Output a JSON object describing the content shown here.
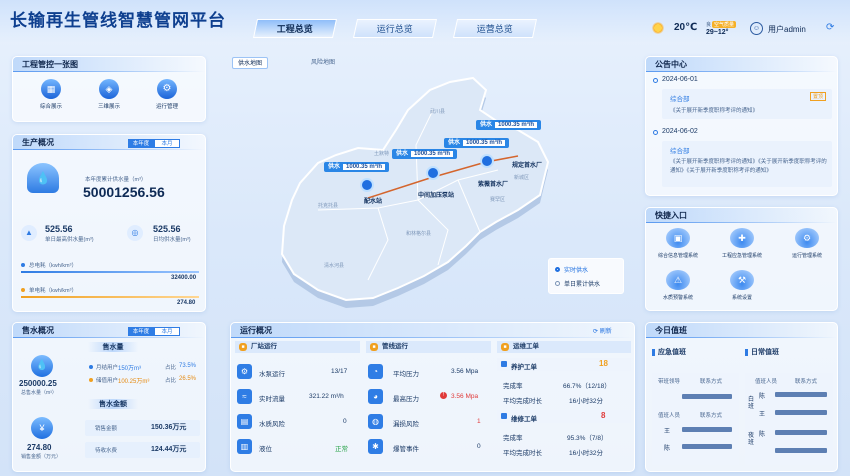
{
  "header": {
    "title": "长输再生管线智慧管网平台",
    "user": "用户admin",
    "weather": {
      "temp": "20℃",
      "aqi_label": "良",
      "aqi": "空气质量",
      "range": "29~12°"
    }
  },
  "tabs": [
    {
      "label": "工程总览",
      "active": true
    },
    {
      "label": "运行总览",
      "active": false
    },
    {
      "label": "运营总览",
      "active": false
    }
  ],
  "left": {
    "eng": {
      "title": "工程管控一张图",
      "items": [
        "综合展示",
        "三维展示",
        "运行管理"
      ]
    },
    "prod": {
      "title": "生产概况",
      "seg": [
        "本年度",
        "本月"
      ],
      "meter_label": "本年度累计供水量（m³）",
      "meter_value": "50001256.56",
      "max_value": "525.56",
      "max_label": "单日最高供水量(m³)",
      "avg_value": "525.56",
      "avg_label": "日均供水量(m³)",
      "elec1_label": "总电耗（kwh/km³）",
      "elec1_value": "32400.00",
      "elec2_label": "单电耗（kwh/km³）",
      "elec2_value": "274.80"
    },
    "sale": {
      "title": "售水概况",
      "seg": [
        "本年度",
        "本月"
      ],
      "vol_label": "售水量",
      "amt_label": "售水金额",
      "sum_value": "250000.25",
      "sum_label": "总售水量（m³）",
      "u1": "月结用户",
      "u1v": "150万m³",
      "u1p": "占比",
      "u1pv": "73.5%",
      "u2": "储值用户",
      "u2v": "100.25万m³",
      "u2p": "占比",
      "u2pv": "26.5%",
      "money_value": "274.80",
      "money_label": "销售金额（万元）",
      "r1": "销售金额",
      "r1v": "150.36万元",
      "r2": "待收水费",
      "r2v": "124.44万元"
    }
  },
  "map": {
    "toggle": [
      "供水地图",
      "风险地图"
    ],
    "stations": [
      {
        "name": "中间加压泵站"
      },
      {
        "name": "配水站"
      },
      {
        "name": "紫薇首水厂"
      },
      {
        "name": "规定首水厂"
      }
    ],
    "flows": [
      {
        "label": "供水",
        "value": "1000.35 m³/h"
      },
      {
        "label": "供水",
        "value": "1000.35 m³/h"
      },
      {
        "label": "供水",
        "value": "1000.35 m³/h"
      },
      {
        "label": "供水",
        "value": "1000.35 m³/h"
      }
    ],
    "regions": [
      "武川县",
      "土默特",
      "赛罕区",
      "新城区",
      "和林格尔县",
      "清水河县",
      "托克托县"
    ],
    "legend": [
      "实时供水",
      "单日累计供水"
    ]
  },
  "ops": {
    "title": "运行概况",
    "refresh": "刷新",
    "plant": {
      "title": "厂站运行",
      "rows": [
        {
          "k": "水泵运行",
          "v": "13/17"
        },
        {
          "k": "实时流量",
          "v": "321.22 m³/h"
        },
        {
          "k": "水质风险",
          "v": "0"
        },
        {
          "k": "液位",
          "v": "正常"
        }
      ]
    },
    "pipe": {
      "title": "管线运行",
      "rows": [
        {
          "k": "平均压力",
          "v": "3.56 Mpa"
        },
        {
          "k": "最高压力",
          "v": "3.56 Mpa"
        },
        {
          "k": "漏损风险",
          "v": "1"
        },
        {
          "k": "爆管事件",
          "v": "0"
        }
      ]
    },
    "work": {
      "title": "运维工单",
      "a_title": "养护工单",
      "a_count": "18",
      "a_rate_k": "完成率",
      "a_rate_v": "66.7%（12/18）",
      "a_time_k": "平均完成时长",
      "a_time_v": "16小时32分",
      "b_title": "维修工单",
      "b_count": "8",
      "b_rate_k": "完成率",
      "b_rate_v": "95.3%（7/8）",
      "b_time_k": "平均完成时长",
      "b_time_v": "16小时32分"
    }
  },
  "right": {
    "notice": {
      "title": "公告中心",
      "items": [
        {
          "date": "2024-06-01",
          "dept": "综合部",
          "tag": "置顶",
          "text": "《关于展开新季度职称考评的通知》"
        },
        {
          "date": "2024-06-02",
          "dept": "综合部",
          "tag": "",
          "text": "《关于展开新季度职称考评的通知》《关于展开新季度职称考评的通知》《关于展开新季度职称考评的通知》"
        }
      ]
    },
    "quick": {
      "title": "快捷入口",
      "items": [
        "综合信息管理系统",
        "工程应急管理系统",
        "运行管理系统",
        "水质预警系统",
        "系统设置"
      ]
    },
    "duty": {
      "title": "今日值班",
      "emerg": "应急值班",
      "daily": "日常值班",
      "c1": [
        "带班领导",
        "联系方式"
      ],
      "c2": [
        "值班人员",
        "联系方式"
      ],
      "row2": [
        "值班人员",
        "联系方式"
      ],
      "day": "白班",
      "night": "夜班",
      "n1": "陈",
      "n2": "王",
      "n3": "陈",
      "n4": "王",
      "n5": "陈"
    }
  }
}
